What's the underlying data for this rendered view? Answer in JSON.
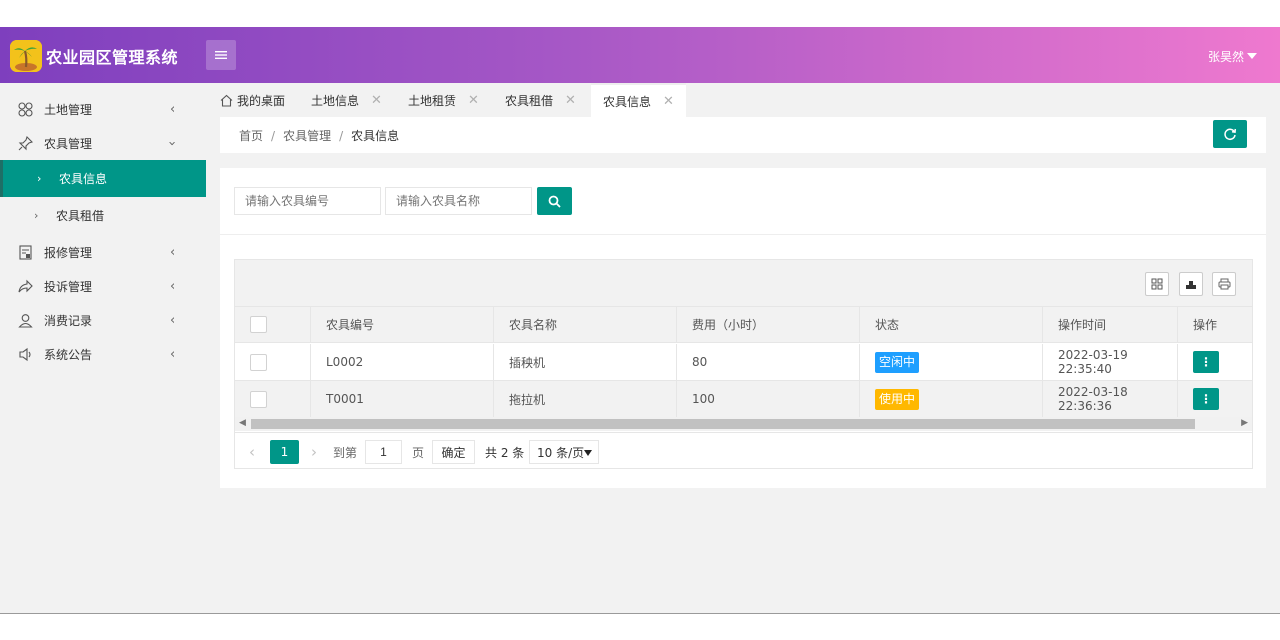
{
  "app": {
    "title": "农业园区管理系统",
    "user": "张昊然"
  },
  "colors": {
    "accent": "#009688",
    "free": "#1e9fff",
    "in_use": "#ffb800",
    "header_start": "#7e3fbe",
    "header_end": "#ef79cf"
  },
  "sidebar": {
    "items": [
      {
        "label": "土地管理",
        "icon": "land-grid-icon"
      },
      {
        "label": "农具管理",
        "icon": "pin-icon"
      },
      {
        "label": "农具信息"
      },
      {
        "label": "农具租借"
      },
      {
        "label": "报修管理",
        "icon": "repair-doc-icon"
      },
      {
        "label": "投诉管理",
        "icon": "share-arrow-icon"
      },
      {
        "label": "消费记录",
        "icon": "user-icon"
      },
      {
        "label": "系统公告",
        "icon": "speaker-icon"
      }
    ]
  },
  "tabs": [
    {
      "label": "我的桌面"
    },
    {
      "label": "土地信息"
    },
    {
      "label": "土地租赁"
    },
    {
      "label": "农具租借"
    },
    {
      "label": "农具信息"
    }
  ],
  "breadcrumb": {
    "home": "首页",
    "section": "农具管理",
    "current": "农具信息",
    "sep": "/"
  },
  "search": {
    "code_placeholder": "请输入农具编号",
    "name_placeholder": "请输入农具名称"
  },
  "table": {
    "columns": [
      "农具编号",
      "农具名称",
      "费用（小时）",
      "状态",
      "操作时间",
      "操作"
    ],
    "rows": [
      {
        "code": "L0002",
        "name": "插秧机",
        "fee": "80",
        "status": "空闲中",
        "time": "2022-03-19 22:35:40",
        "op": "⋮"
      },
      {
        "code": "T0001",
        "name": "拖拉机",
        "fee": "100",
        "status": "使用中",
        "time": "2022-03-18 22:36:36",
        "op": "⋮"
      }
    ]
  },
  "pager": {
    "current": "1",
    "goto_label": "到第",
    "goto_value": "1",
    "page_unit": "页",
    "confirm": "确定",
    "total": "共 2 条",
    "page_size": "10 条/页"
  }
}
